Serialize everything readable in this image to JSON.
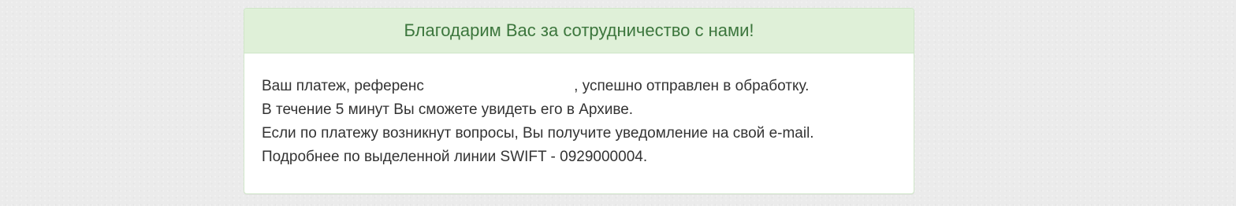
{
  "panel": {
    "title": "Благодарим Вас за сотрудничество с нами!",
    "message": {
      "line1_prefix": "Ваш платеж, референс",
      "line1_reference": "",
      "line1_suffix": ", успешно отправлен в обработку.",
      "line2": "В течение 5 минут Вы сможете увидеть его в Архиве.",
      "line3": "Если по платежу возникнут вопросы, Вы получите уведомление на свой e-mail.",
      "line4": "Подробнее по выделенной линии SWIFT - 0929000004."
    }
  },
  "colors": {
    "page_background": "#ebebeb",
    "heading_background": "#dff0d8",
    "heading_text": "#3c763d",
    "border": "#cfe6c8",
    "body_text": "#333333"
  }
}
